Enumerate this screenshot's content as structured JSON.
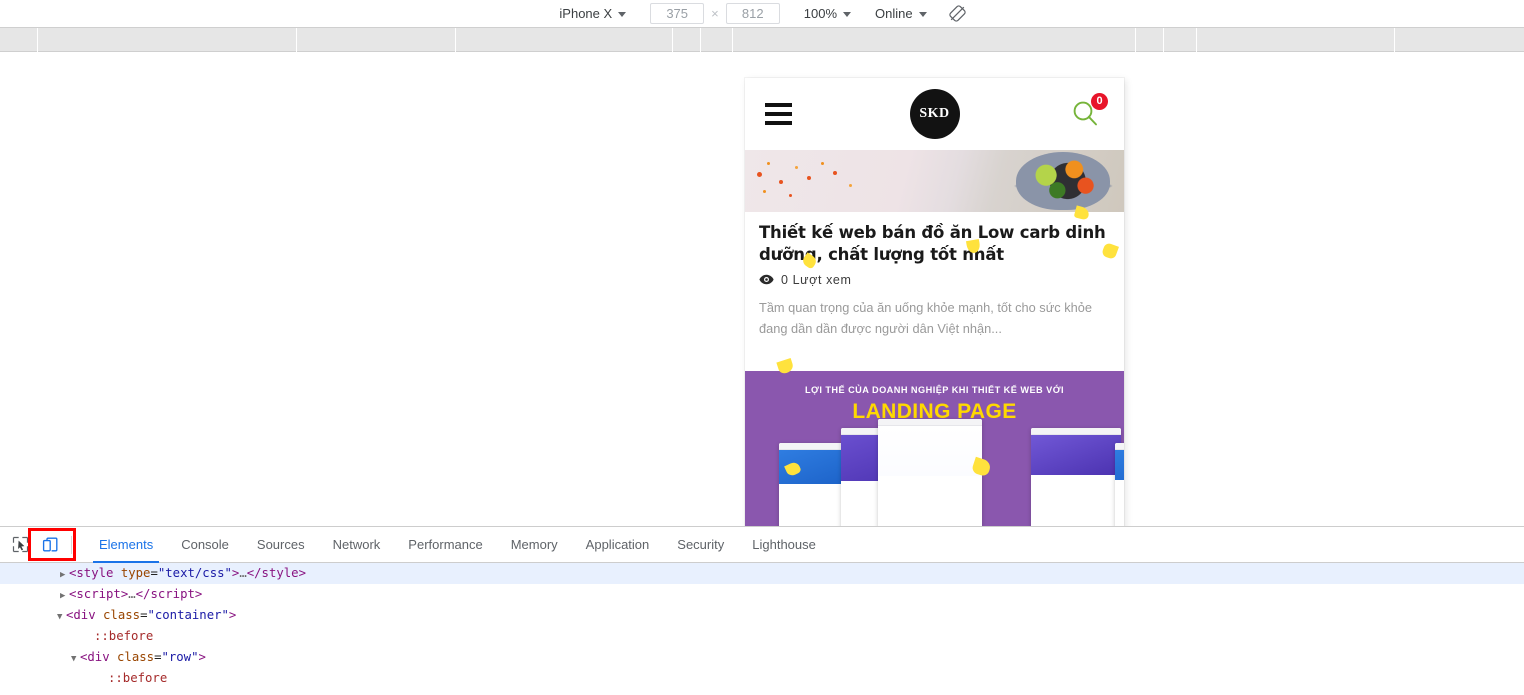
{
  "device_toolbar": {
    "device": "iPhone X",
    "width_value": "375",
    "height_value": "812",
    "times": "×",
    "zoom": "100%",
    "network": "Online",
    "rotate_icon": "rotate-device-icon"
  },
  "devtools": {
    "inspect_icon": "inspect-element-icon",
    "device_toggle_icon": "toggle-device-toolbar-icon",
    "tabs": [
      {
        "label": "Elements",
        "active": true
      },
      {
        "label": "Console",
        "active": false
      },
      {
        "label": "Sources",
        "active": false
      },
      {
        "label": "Network",
        "active": false
      },
      {
        "label": "Performance",
        "active": false
      },
      {
        "label": "Memory",
        "active": false
      },
      {
        "label": "Application",
        "active": false
      },
      {
        "label": "Security",
        "active": false
      },
      {
        "label": "Lighthouse",
        "active": false
      }
    ],
    "dom_rows": [
      {
        "indent": 60,
        "twisty": "▶",
        "selected": true,
        "parts": [
          {
            "t": "punc",
            "v": "<"
          },
          {
            "t": "tag",
            "v": "style"
          },
          {
            "t": "plain",
            "v": " "
          },
          {
            "t": "attr",
            "v": "type"
          },
          {
            "t": "plain",
            "v": "="
          },
          {
            "t": "val",
            "v": "\"text/css\""
          },
          {
            "t": "punc",
            "v": ">"
          },
          {
            "t": "ell",
            "v": "…"
          },
          {
            "t": "punc",
            "v": "</"
          },
          {
            "t": "tag",
            "v": "style"
          },
          {
            "t": "punc",
            "v": ">"
          }
        ]
      },
      {
        "indent": 60,
        "twisty": "▶",
        "selected": false,
        "parts": [
          {
            "t": "punc",
            "v": "<"
          },
          {
            "t": "tag",
            "v": "script"
          },
          {
            "t": "punc",
            "v": ">"
          },
          {
            "t": "ell",
            "v": "…"
          },
          {
            "t": "punc",
            "v": "</"
          },
          {
            "t": "tag",
            "v": "script"
          },
          {
            "t": "punc",
            "v": ">"
          }
        ]
      },
      {
        "indent": 57,
        "twisty": "▼",
        "selected": false,
        "parts": [
          {
            "t": "punc",
            "v": "<"
          },
          {
            "t": "tag",
            "v": "div"
          },
          {
            "t": "plain",
            "v": " "
          },
          {
            "t": "attr",
            "v": "class"
          },
          {
            "t": "plain",
            "v": "="
          },
          {
            "t": "val",
            "v": "\"container\""
          },
          {
            "t": "punc",
            "v": ">"
          }
        ]
      },
      {
        "indent": 85,
        "twisty": "",
        "selected": false,
        "parts": [
          {
            "t": "pseudo",
            "v": "::before"
          }
        ]
      },
      {
        "indent": 71,
        "twisty": "▼",
        "selected": false,
        "parts": [
          {
            "t": "punc",
            "v": "<"
          },
          {
            "t": "tag",
            "v": "div"
          },
          {
            "t": "plain",
            "v": " "
          },
          {
            "t": "attr",
            "v": "class"
          },
          {
            "t": "plain",
            "v": "="
          },
          {
            "t": "val",
            "v": "\"row\""
          },
          {
            "t": "punc",
            "v": ">"
          }
        ]
      },
      {
        "indent": 99,
        "twisty": "",
        "selected": false,
        "parts": [
          {
            "t": "pseudo",
            "v": "::before"
          }
        ]
      }
    ]
  },
  "page": {
    "brand": "SKD",
    "menu_icon": "hamburger-menu-icon",
    "search_icon": "search-icon",
    "search_badge": "0",
    "article": {
      "title": "Thiết kế web bán đồ ăn Low carb dinh dưỡng, chất lượng tốt nhất",
      "views_icon": "eye-icon",
      "views": "0 Lượt xem",
      "excerpt": "Tầm quan trọng của ăn uống khỏe mạnh, tốt cho sức khỏe đang dần dần được người dân Việt nhận..."
    },
    "banner": {
      "subtitle": "LỢI THẾ CỦA DOANH NGHIỆP KHI THIẾT KẾ WEB VỚI",
      "title": "LANDING PAGE",
      "bg_color": "#8a57ae",
      "title_color": "#ffd900"
    }
  }
}
